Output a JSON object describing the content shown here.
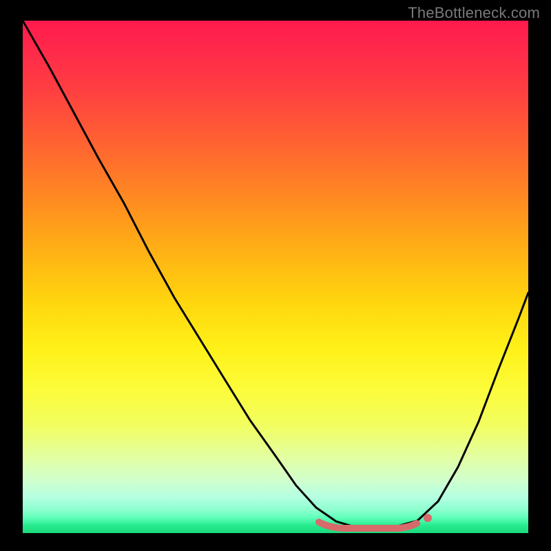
{
  "watermark": "TheBottleneck.com",
  "colors": {
    "frame": "#000000",
    "curve": "#000000",
    "flat_segment": "#d76b6b",
    "dot": "#d76b6b",
    "gradient_top": "#ff1a4d",
    "gradient_bottom": "#1dd97d"
  },
  "chart_data": {
    "type": "line",
    "title": "",
    "xlabel": "",
    "ylabel": "",
    "xlim": [
      0,
      100
    ],
    "ylim": [
      0,
      100
    ],
    "grid": false,
    "legend": false,
    "notes": "No axis ticks or numeric labels are visible; x and y are expressed as percentage of plot width/height. y=0 is the bottom (green). Curve shape estimated from pixels.",
    "series": [
      {
        "name": "bottleneck_curve",
        "x": [
          0,
          5,
          10,
          15,
          20,
          25,
          30,
          35,
          40,
          45,
          50,
          54,
          58,
          62,
          66,
          70,
          74,
          78,
          82,
          86,
          90,
          94,
          98,
          100
        ],
        "y": [
          100,
          91,
          82,
          73,
          64,
          55,
          46,
          38,
          30,
          22,
          15,
          9,
          5,
          2,
          1,
          1,
          1,
          2,
          6,
          13,
          22,
          32,
          42,
          47
        ]
      }
    ],
    "flat_region": {
      "x_start": 58,
      "x_end": 78,
      "y": 1
    },
    "marker": {
      "x": 78,
      "y": 2
    },
    "gradient_stops_pct_from_top": {
      "red": 0,
      "orange": 36,
      "yellow": 64,
      "pale": 90,
      "green": 100
    }
  }
}
